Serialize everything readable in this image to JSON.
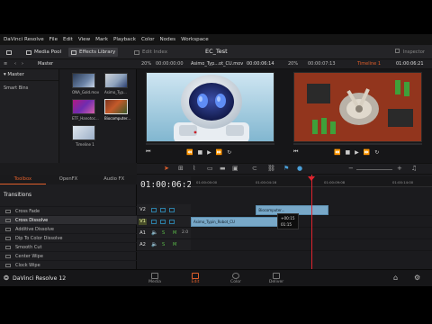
{
  "app": {
    "name": "DaVinci Resolve"
  },
  "menu": [
    "DaVinci Resolve",
    "File",
    "Edit",
    "View",
    "Mark",
    "Playback",
    "Color",
    "Nodes",
    "Workspace"
  ],
  "toolbar": {
    "media_pool": "Media Pool",
    "effects_library": "Effects Library",
    "edit_index": "Edit Index",
    "project_title": "EC_Test",
    "inspector": "Inspector"
  },
  "subbar": {
    "panel_title": "Master",
    "source_zoom": "20%",
    "source_tc_left": "00:00:00:00",
    "source_clip": "Asimo_Typ...ot_CU.mov",
    "source_tc_right": "00:00:06:14",
    "timeline_zoom": "20%",
    "timeline_tc_left": "00:00:07:13",
    "timeline_name": "Timeline 1",
    "timeline_tc_right": "01:00:06:21"
  },
  "left_panel": {
    "header": "Master",
    "smart_bins": "Smart Bins"
  },
  "media_pool": {
    "clips": [
      {
        "name": "ONA_Gold.mov"
      },
      {
        "name": "Asimo_Typ..."
      },
      {
        "name": "ETF_Hanotoc..."
      },
      {
        "name": "Biocomputer..."
      },
      {
        "name": "Timeline 1"
      }
    ]
  },
  "effects": {
    "tabs": [
      "Toolbox",
      "OpenFX",
      "Audio FX"
    ],
    "active_tab": "Toolbox",
    "section": "Transitions",
    "items": [
      "Cross Fade",
      "Cross Dissolve",
      "Additive Dissolve",
      "Dip To Color Dissolve",
      "Smooth Cut",
      "Center Wipe",
      "Clock Wipe"
    ],
    "selected": "Cross Dissolve"
  },
  "timeline": {
    "timecode": "01:00:06:21",
    "ruler": [
      "01:00:00:00",
      "01:00:04:16",
      "01:00:09:08",
      "01:00:14:00"
    ],
    "tracks": [
      {
        "id": "V2",
        "clips": [
          {
            "label": "Biocomputer...",
            "start": 0.27,
            "end": 0.57
          }
        ]
      },
      {
        "id": "V1",
        "clips": [
          {
            "label": "Asimo_Typin_Robot_CU",
            "start": 0.0,
            "end": 0.4
          }
        ]
      },
      {
        "id": "A1",
        "clips": []
      },
      {
        "id": "A2",
        "clips": []
      }
    ],
    "a1_level": "2.0",
    "tooltip": [
      "+00:15",
      "01:15"
    ],
    "playhead": 0.5
  },
  "pages": {
    "brand": "DaVinci Resolve 12",
    "tabs": [
      "Media",
      "Edit",
      "Color",
      "Deliver"
    ],
    "active": "Edit"
  },
  "colors": {
    "accent": "#e15f2b",
    "clip": "#78a8c8",
    "playhead": "#e0242e"
  }
}
